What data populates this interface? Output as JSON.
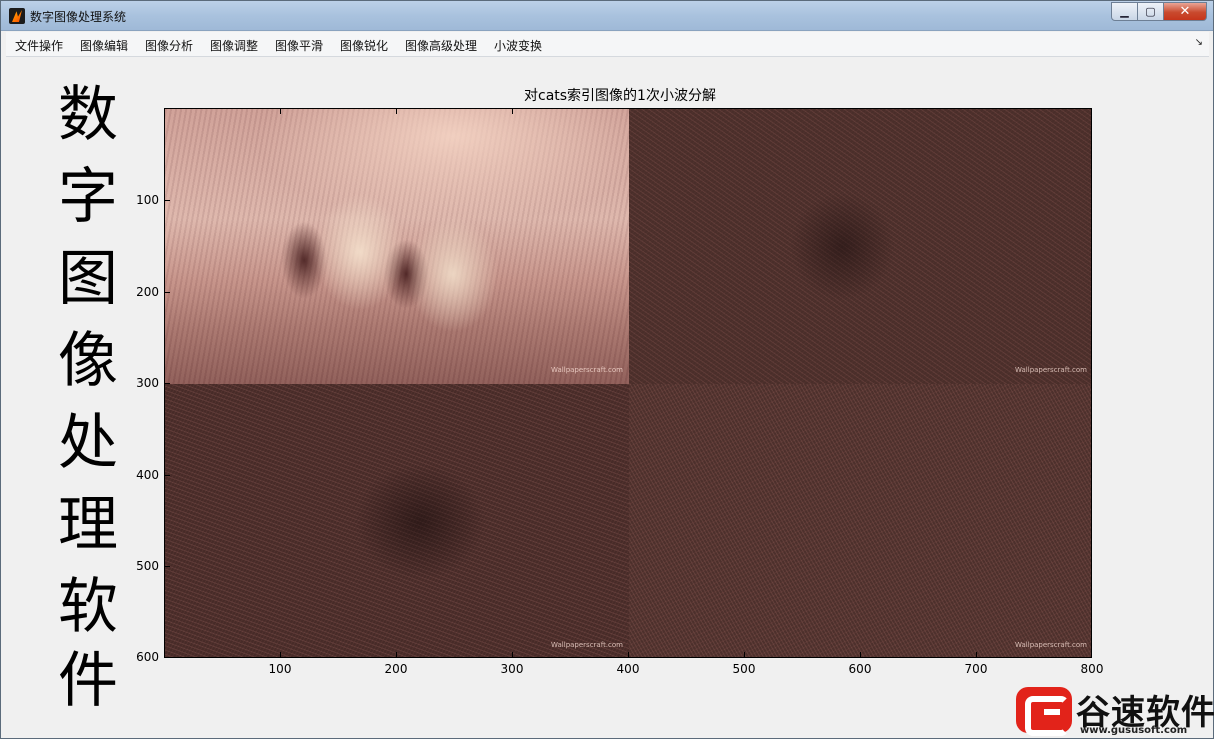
{
  "window": {
    "title": "数字图像处理系统"
  },
  "window_buttons": {
    "minimize": "▁",
    "maximize": "▢",
    "close": "✕"
  },
  "menu": {
    "items": [
      "文件操作",
      "图像编辑",
      "图像分析",
      "图像调整",
      "图像平滑",
      "图像锐化",
      "图像高级处理",
      "小波变换"
    ],
    "corner": "↘"
  },
  "side_text": [
    "数",
    "字",
    "图",
    "像",
    "处",
    "理",
    "软",
    "件"
  ],
  "plot": {
    "title": "对cats索引图像的1次小波分解",
    "y_ticks": [
      "100",
      "200",
      "300",
      "400",
      "500",
      "600"
    ],
    "x_ticks": [
      "100",
      "200",
      "300",
      "400",
      "500",
      "600",
      "700",
      "800"
    ],
    "quadrant_watermark": "Wallpaperscraft.com"
  },
  "logo": {
    "text": "谷速软件",
    "url": "www.gususoft.com"
  },
  "colors": {
    "image_tint": "#c8968c",
    "logo_red": "#e2231a"
  },
  "icons": [
    "matlab-icon",
    "minimize-icon",
    "maximize-icon",
    "close-icon"
  ]
}
